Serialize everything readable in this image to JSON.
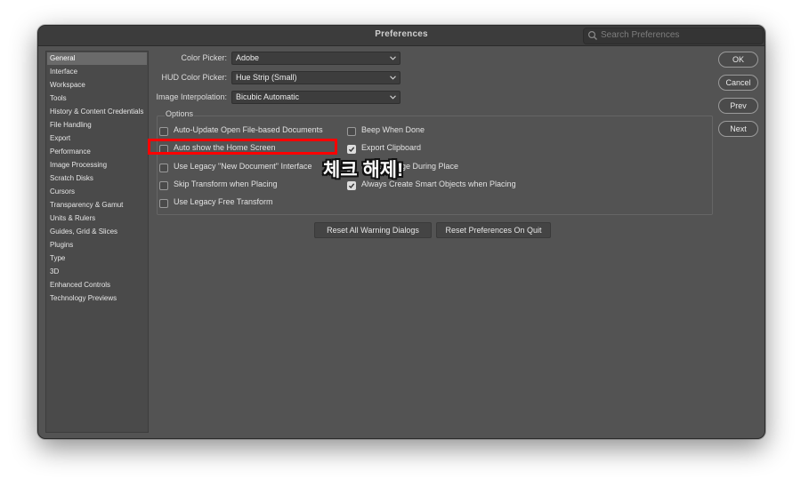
{
  "window": {
    "title": "Preferences"
  },
  "search": {
    "placeholder": "Search Preferences"
  },
  "sidebar": {
    "items": [
      {
        "label": "General"
      },
      {
        "label": "Interface"
      },
      {
        "label": "Workspace"
      },
      {
        "label": "Tools"
      },
      {
        "label": "History & Content Credentials"
      },
      {
        "label": "File Handling"
      },
      {
        "label": "Export"
      },
      {
        "label": "Performance"
      },
      {
        "label": "Image Processing"
      },
      {
        "label": "Scratch Disks"
      },
      {
        "label": "Cursors"
      },
      {
        "label": "Transparency & Gamut"
      },
      {
        "label": "Units & Rulers"
      },
      {
        "label": "Guides, Grid & Slices"
      },
      {
        "label": "Plugins"
      },
      {
        "label": "Type"
      },
      {
        "label": "3D"
      },
      {
        "label": "Enhanced Controls"
      },
      {
        "label": "Technology Previews"
      }
    ],
    "selected": "General"
  },
  "settings": {
    "color_picker": {
      "label": "Color Picker:",
      "value": "Adobe"
    },
    "hud_color_picker": {
      "label": "HUD Color Picker:",
      "value": "Hue Strip (Small)"
    },
    "image_interpolation": {
      "label": "Image Interpolation:",
      "value": "Bicubic Automatic"
    }
  },
  "options": {
    "title": "Options",
    "left": [
      {
        "label": "Auto-Update Open File-based Documents",
        "checked": false
      },
      {
        "label": "Auto show the Home Screen",
        "checked": false
      },
      {
        "label": "Use Legacy \"New Document\" Interface",
        "checked": false
      },
      {
        "label": "Skip Transform when Placing",
        "checked": false
      },
      {
        "label": "Use Legacy Free Transform",
        "checked": false
      }
    ],
    "right": [
      {
        "label": "Beep When Done",
        "checked": false
      },
      {
        "label": "Export Clipboard",
        "checked": true
      },
      {
        "label": "Resize Image During Place",
        "checked": true
      },
      {
        "label": "Always Create Smart Objects when Placing",
        "checked": true
      }
    ]
  },
  "buttons": {
    "ok": "OK",
    "cancel": "Cancel",
    "prev": "Prev",
    "next": "Next",
    "reset_warning": "Reset All Warning Dialogs",
    "reset_prefs": "Reset Preferences On Quit"
  },
  "annotation": {
    "text": "체크 해제!",
    "highlight_color": "#ff0000"
  }
}
